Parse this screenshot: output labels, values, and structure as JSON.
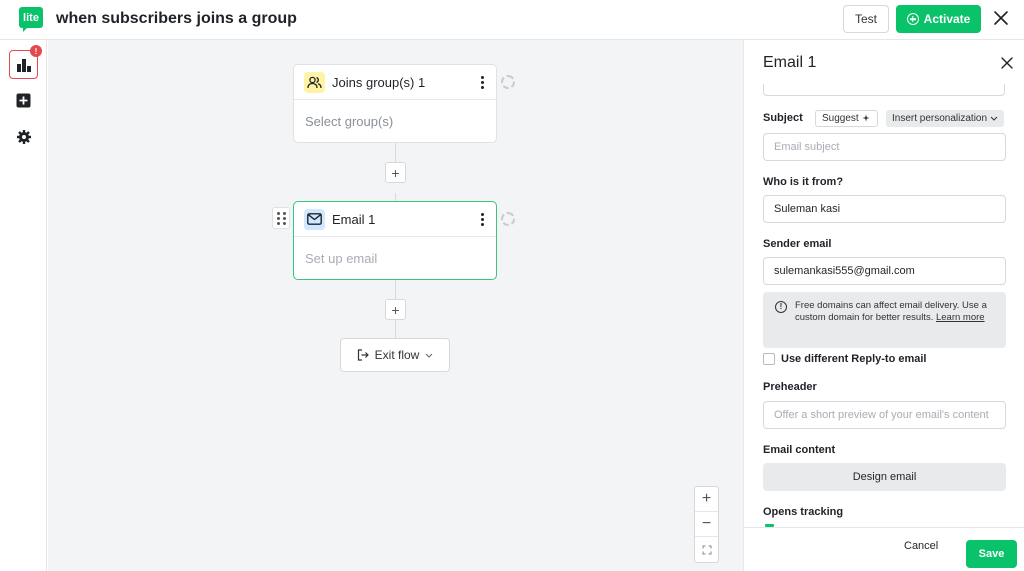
{
  "header": {
    "logo_text": "lite",
    "title": "when subscribers joins a group",
    "test_label": "Test",
    "activate_label": "Activate"
  },
  "rail": {
    "badge": "!"
  },
  "canvas": {
    "trigger_node": {
      "label": "Joins group(s) 1",
      "body": "Select group(s)"
    },
    "email_node": {
      "label": "Email 1",
      "body": "Set up email"
    },
    "plus_label": "+",
    "exit_label": "Exit flow",
    "zoom_in": "+",
    "zoom_out": "−"
  },
  "panel": {
    "title": "Email 1",
    "subject_label": "Subject",
    "suggest_label": "Suggest",
    "insert_label": "Insert personalization",
    "subject_placeholder": "Email subject",
    "from_label": "Who is it from?",
    "from_value": "Suleman kasi",
    "sender_label": "Sender email",
    "sender_value": "sulemankasi555@gmail.com",
    "notice_text": "Free domains can affect email delivery. Use a custom domain for better results.",
    "notice_link": "Learn more",
    "reply_to_label": "Use different Reply-to email",
    "preheader_label": "Preheader",
    "preheader_placeholder": "Offer a short preview of your email's content",
    "content_label": "Email content",
    "design_label": "Design email",
    "tracking_label": "Opens tracking",
    "cancel_label": "Cancel",
    "save_label": "Save"
  },
  "colors": {
    "brand": "#09c269",
    "alert": "#e5484d"
  }
}
